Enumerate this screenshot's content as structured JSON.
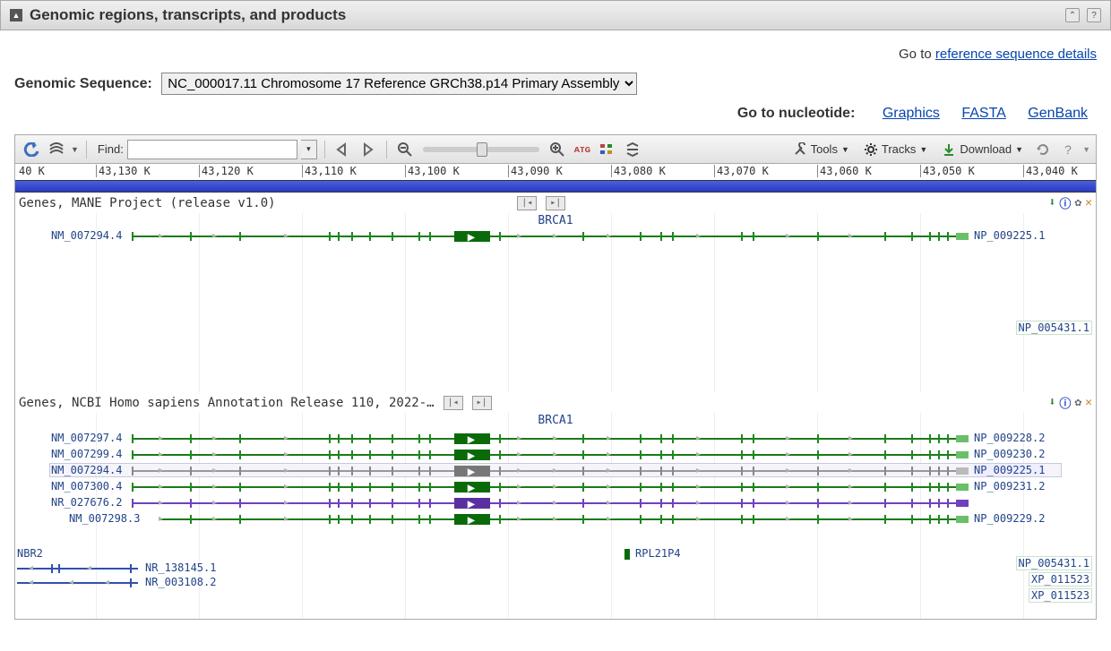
{
  "panel": {
    "title": "Genomic regions, transcripts, and products"
  },
  "links": {
    "ref_seq_details_prefix": "Go to ",
    "ref_seq_details": "reference sequence details",
    "nucleotide_prefix": "Go to nucleotide:",
    "graphics": "Graphics",
    "fasta": "FASTA",
    "genbank": "GenBank"
  },
  "sequence_selector": {
    "label": "Genomic Sequence:",
    "selected": "NC_000017.11 Chromosome 17 Reference GRCh38.p14 Primary Assembly"
  },
  "toolbar": {
    "find_label": "Find:",
    "tools": "Tools",
    "tracks": "Tracks",
    "download": "Download"
  },
  "ruler": {
    "start_label": "40 K",
    "ticks": [
      "43,130 K",
      "43,120 K",
      "43,110 K",
      "43,100 K",
      "43,090 K",
      "43,080 K",
      "43,070 K",
      "43,060 K",
      "43,050 K",
      "43,040 K"
    ]
  },
  "tracks": {
    "mane": {
      "title": "Genes, MANE Project (release v1.0)",
      "gene_label": "BRCA1",
      "transcript": {
        "acc": "NM_007294.4",
        "protein": "NP_009225.1"
      },
      "extra_protein": "NP_005431.1"
    },
    "ncbi": {
      "title": "Genes, NCBI Homo sapiens Annotation Release 110, 2022-…",
      "gene_label": "BRCA1",
      "rows": [
        {
          "acc": "NM_007297.4",
          "protein": "NP_009228.2",
          "color": "green"
        },
        {
          "acc": "NM_007299.4",
          "protein": "NP_009230.2",
          "color": "green"
        },
        {
          "acc": "NM_007294.4",
          "protein": "NP_009225.1",
          "color": "grey",
          "selected": true
        },
        {
          "acc": "NM_007300.4",
          "protein": "NP_009231.2",
          "color": "green"
        },
        {
          "acc": "NR_027676.2",
          "protein": "",
          "color": "purple"
        },
        {
          "acc": "NM_007298.3",
          "protein": "NP_009229.2",
          "color": "green"
        }
      ],
      "nbr2": {
        "label": "NBR2",
        "rows": [
          "NR_138145.1",
          "NR_003108.2"
        ]
      },
      "rpl21p4": "RPL21P4",
      "right_proteins": [
        "NP_005431.1",
        "XP_011523(truncated)",
        "XP_011523(truncated)"
      ],
      "right_proteins_display": [
        "NP_005431.1",
        "XP_011523",
        "XP_011523"
      ]
    }
  }
}
